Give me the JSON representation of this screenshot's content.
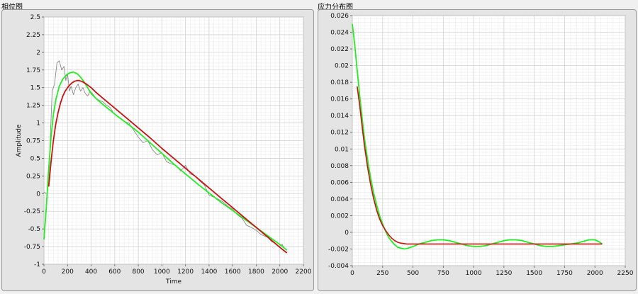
{
  "charts": [
    {
      "panel_title": "相位图",
      "chart_data": {
        "type": "line",
        "xlabel": "Time",
        "ylabel": "Amplitude",
        "xlim": [
          0,
          2200
        ],
        "ylim": [
          -1,
          2.5
        ],
        "xticks": [
          "0",
          "200",
          "400",
          "600",
          "800",
          "1000",
          "1200",
          "1400",
          "1600",
          "1800",
          "2000",
          "2200"
        ],
        "yticks": [
          "-1",
          "-0.75",
          "-0.5",
          "-0.25",
          "0",
          "0.25",
          "0.5",
          "0.75",
          "1",
          "1.25",
          "1.5",
          "1.75",
          "2",
          "2.25",
          "2.5"
        ],
        "series": [
          {
            "color": "#8a8a8a",
            "width": 0.9,
            "x": [
              0,
              25,
              40,
              55,
              70,
              90,
              110,
              130,
              150,
              170,
              185,
              200,
              215,
              230,
              250,
              270,
              290,
              310,
              330,
              350,
              370,
              390,
              410,
              440,
              470,
              500,
              530,
              560,
              600,
              640,
              680,
              720,
              760,
              800,
              840,
              880,
              920,
              960,
              1000,
              1040,
              1080,
              1120,
              1160,
              1200,
              1240,
              1280,
              1320,
              1360,
              1400,
              1440,
              1480,
              1520,
              1560,
              1600,
              1640,
              1680,
              1720,
              1760,
              1800,
              1840,
              1870,
              1900,
              1930,
              1960,
              1990,
              2020,
              2040,
              2060
            ],
            "y": [
              0.02,
              0.0,
              0.15,
              0.85,
              1.45,
              1.55,
              1.85,
              1.88,
              1.75,
              1.8,
              1.6,
              1.7,
              1.45,
              1.52,
              1.4,
              1.5,
              1.55,
              1.45,
              1.5,
              1.42,
              1.38,
              1.45,
              1.42,
              1.35,
              1.32,
              1.3,
              1.25,
              1.22,
              1.12,
              1.08,
              1.02,
              1.0,
              0.9,
              0.8,
              0.72,
              0.75,
              0.62,
              0.55,
              0.58,
              0.45,
              0.42,
              0.4,
              0.32,
              0.4,
              0.28,
              0.25,
              0.18,
              0.12,
              -0.02,
              -0.05,
              -0.08,
              -0.12,
              -0.18,
              -0.22,
              -0.3,
              -0.35,
              -0.45,
              -0.48,
              -0.52,
              -0.58,
              -0.6,
              -0.62,
              -0.68,
              -0.7,
              -0.75,
              -0.72,
              -0.78,
              -0.8
            ]
          },
          {
            "color": "#22ee22",
            "width": 1.8,
            "x": [
              0,
              20,
              40,
              60,
              80,
              100,
              130,
              160,
              190,
              220,
              250,
              280,
              310,
              340,
              370,
              400,
              440,
              500,
              560,
              620,
              700,
              800,
              900,
              1000,
              1100,
              1200,
              1300,
              1400,
              1500,
              1600,
              1700,
              1800,
              1900,
              2000,
              2060
            ],
            "y": [
              -0.65,
              -0.2,
              0.35,
              0.8,
              1.12,
              1.32,
              1.52,
              1.62,
              1.68,
              1.71,
              1.72,
              1.7,
              1.65,
              1.58,
              1.5,
              1.42,
              1.35,
              1.26,
              1.18,
              1.1,
              1.0,
              0.87,
              0.72,
              0.57,
              0.42,
              0.28,
              0.14,
              0.01,
              -0.12,
              -0.24,
              -0.36,
              -0.48,
              -0.6,
              -0.72,
              -0.8
            ]
          },
          {
            "color": "#cc1111",
            "width": 1.8,
            "x": [
              40,
              60,
              80,
              100,
              120,
              140,
              160,
              180,
              200,
              220,
              240,
              260,
              280,
              300,
              330,
              360,
              400,
              450,
              500,
              600,
              700,
              800,
              900,
              1000,
              1100,
              1200,
              1300,
              1400,
              1500,
              1600,
              1700,
              1800,
              1900,
              2000,
              2060
            ],
            "y": [
              0.1,
              0.45,
              0.75,
              0.98,
              1.15,
              1.28,
              1.38,
              1.45,
              1.5,
              1.54,
              1.57,
              1.59,
              1.6,
              1.6,
              1.58,
              1.55,
              1.5,
              1.42,
              1.35,
              1.21,
              1.07,
              0.93,
              0.79,
              0.64,
              0.5,
              0.36,
              0.22,
              0.08,
              -0.06,
              -0.2,
              -0.34,
              -0.48,
              -0.62,
              -0.76,
              -0.84
            ]
          }
        ]
      }
    },
    {
      "panel_title": "应力分布图",
      "chart_data": {
        "type": "line",
        "xlabel": "",
        "ylabel": "",
        "xlim": [
          0,
          2250
        ],
        "ylim": [
          -0.004,
          0.026
        ],
        "xticks": [
          "0",
          "250",
          "500",
          "750",
          "1000",
          "1250",
          "1500",
          "1750",
          "2000",
          "2250"
        ],
        "yticks": [
          "-0.004",
          "-0.002",
          "0",
          "0.002",
          "0.004",
          "0.006",
          "0.008",
          "0.01",
          "0.012",
          "0.014",
          "0.016",
          "0.018",
          "0.02",
          "0.022",
          "0.024",
          "0.026"
        ],
        "series": [
          {
            "color": "#22ee22",
            "width": 1.8,
            "x": [
              0,
              20,
              40,
              60,
              80,
              100,
              125,
              150,
              175,
              200,
              225,
              250,
              275,
              300,
              325,
              350,
              375,
              400,
              430,
              460,
              500,
              550,
              600,
              650,
              700,
              750,
              800,
              850,
              900,
              950,
              1000,
              1050,
              1100,
              1150,
              1200,
              1250,
              1300,
              1350,
              1400,
              1450,
              1500,
              1550,
              1600,
              1650,
              1700,
              1750,
              1800,
              1850,
              1900,
              1950,
              2000,
              2030,
              2060
            ],
            "y": [
              0.025,
              0.0225,
              0.0195,
              0.0165,
              0.0138,
              0.0113,
              0.0088,
              0.0066,
              0.0048,
              0.0033,
              0.002,
              0.001,
              0.0001,
              -0.0006,
              -0.0011,
              -0.0015,
              -0.0018,
              -0.0019,
              -0.002,
              -0.0019,
              -0.0017,
              -0.0014,
              -0.0012,
              -0.001,
              -0.0009,
              -0.0009,
              -0.001,
              -0.0012,
              -0.0014,
              -0.0016,
              -0.0017,
              -0.0017,
              -0.0016,
              -0.0014,
              -0.0012,
              -0.001,
              -0.0009,
              -0.0009,
              -0.001,
              -0.0012,
              -0.0014,
              -0.0016,
              -0.0017,
              -0.0017,
              -0.0016,
              -0.0015,
              -0.0014,
              -0.0013,
              -0.0011,
              -0.0009,
              -0.0009,
              -0.0011,
              -0.0014
            ]
          },
          {
            "color": "#cc1111",
            "width": 1.6,
            "x": [
              40,
              60,
              80,
              100,
              125,
              150,
              175,
              200,
              225,
              250,
              275,
              300,
              325,
              350,
              375,
              400,
              450,
              500,
              600,
              800,
              1000,
              1200,
              1400,
              1600,
              1800,
              2000,
              2060
            ],
            "y": [
              0.0175,
              0.0153,
              0.0128,
              0.0104,
              0.0079,
              0.0058,
              0.0041,
              0.0027,
              0.0016,
              0.0008,
              0.0002,
              -0.0003,
              -0.0007,
              -0.001,
              -0.0012,
              -0.0013,
              -0.0014,
              -0.0014,
              -0.0014,
              -0.0014,
              -0.0014,
              -0.0014,
              -0.0014,
              -0.0014,
              -0.0014,
              -0.0014,
              -0.0014
            ]
          }
        ]
      }
    }
  ]
}
